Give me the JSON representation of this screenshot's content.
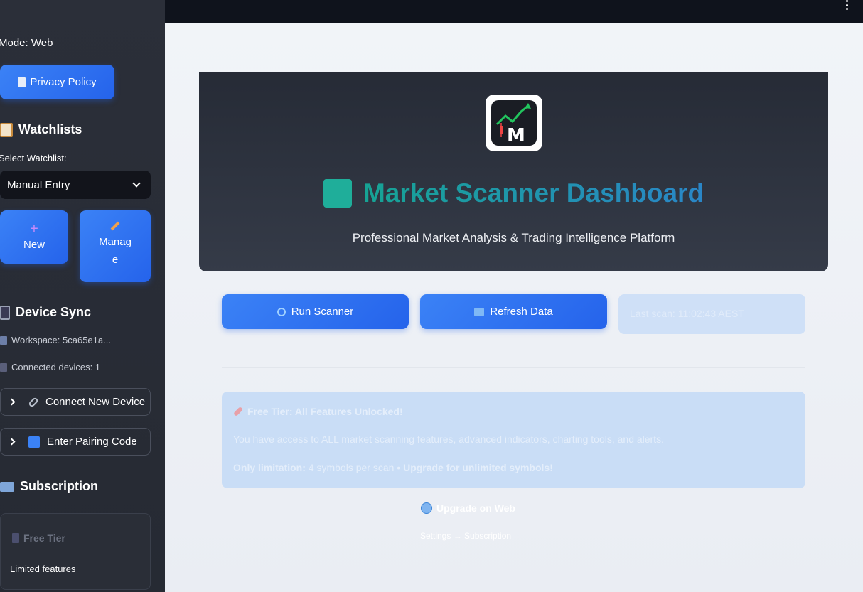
{
  "sidebar": {
    "mode": "Mode: Web",
    "privacy_button": "Privacy Policy",
    "watchlists": {
      "title": "Watchlists",
      "select_label": "Select Watchlist:",
      "selected": "Manual Entry",
      "new_label": "New",
      "manage_label": "Manage"
    },
    "device_sync": {
      "title": "Device Sync",
      "workspace": "Workspace: 5ca65e1a...",
      "connected": "Connected devices: 1",
      "connect_new": "Connect New Device",
      "pairing": "Enter Pairing Code"
    },
    "subscription": {
      "title": "Subscription",
      "tier": "Free Tier",
      "limited": "Limited features"
    }
  },
  "hero": {
    "title": "Market Scanner Dashboard",
    "subtitle": "Professional Market Analysis & Trading Intelligence Platform",
    "logo_letter": "M"
  },
  "actions": {
    "run": "Run Scanner",
    "refresh": "Refresh Data",
    "last_scan": "Last scan: 11:02:43 AEST"
  },
  "info": {
    "heading": "Free Tier: All Features Unlocked!",
    "body": "You have access to ALL market scanning features, advanced indicators, charting tools, and alerts.",
    "limit_label": "Only limitation:",
    "limit_text": " 4 symbols per scan • ",
    "limit_upgrade": "Upgrade for unlimited symbols!"
  },
  "upgrade": {
    "label": "Upgrade on Web",
    "path": "Settings → Subscription"
  },
  "colors": {
    "accent": "#3b82f6",
    "sidebar_bg": "#2b2f39",
    "teal": "#1fae9a"
  }
}
